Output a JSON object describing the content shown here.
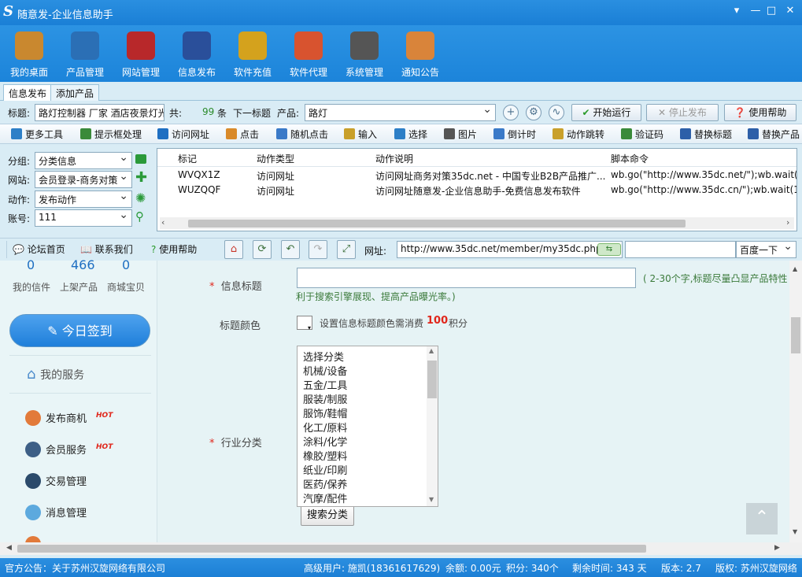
{
  "app": {
    "logo": "S",
    "title": "随意发-企业信息助手",
    "win_controls": [
      "▾",
      "—",
      "□",
      "✕"
    ]
  },
  "toolbar": [
    {
      "label": "我的桌面",
      "icon": "house-icon",
      "color": "#c9882f"
    },
    {
      "label": "产品管理",
      "icon": "cloud-box-icon",
      "color": "#2b6fb5"
    },
    {
      "label": "网站管理",
      "icon": "building-icon",
      "color": "#b8282a"
    },
    {
      "label": "信息发布",
      "icon": "magic-wand-icon",
      "color": "#2a4f9a"
    },
    {
      "label": "软件充值",
      "icon": "chart-coins-icon",
      "color": "#d4a21d"
    },
    {
      "label": "软件代理",
      "icon": "gift-icon",
      "color": "#d8532f"
    },
    {
      "label": "系统管理",
      "icon": "gear-icon",
      "color": "#555555"
    },
    {
      "label": "通知公告",
      "icon": "notepad-icon",
      "color": "#d9843a"
    }
  ],
  "tabs": [
    "信息发布",
    "添加产品"
  ],
  "row1": {
    "title_label": "标题:",
    "title_value": "路灯控制器 厂家 酒店夜景灯光",
    "total_label": "共:",
    "count": "99",
    "unit": "条",
    "next_label": "下一标题",
    "product_label": "产品:",
    "product_value": "路灯",
    "start_label": "开始运行",
    "stop_label": "停止发布",
    "help_label": "使用帮助"
  },
  "row2": [
    {
      "label": "更多工具",
      "color": "#2d7fc7"
    },
    {
      "label": "提示框处理",
      "color": "#3a8a3a"
    },
    {
      "label": "访问网址",
      "color": "#1f6fc2"
    },
    {
      "label": "点击",
      "color": "#d98a2a"
    },
    {
      "label": "随机点击",
      "color": "#3b7ac8"
    },
    {
      "label": "输入",
      "color": "#c9a02a"
    },
    {
      "label": "选择",
      "color": "#2d7fc7"
    },
    {
      "label": "图片",
      "color": "#555555"
    },
    {
      "label": "倒计时",
      "color": "#3b7ac8"
    },
    {
      "label": "动作跳转",
      "color": "#c9a02a"
    },
    {
      "label": "验证码",
      "color": "#3a8a3a"
    },
    {
      "label": "替换标题",
      "color": "#2d5fa8"
    },
    {
      "label": "替换产品",
      "color": "#2d5fa8"
    }
  ],
  "leftform": {
    "group_label": "分组:",
    "group_value": "分类信息",
    "site_label": "网站:",
    "site_value": "会员登录-商务对策",
    "action_label": "动作:",
    "action_value": "发布动作",
    "account_label": "账号:",
    "account_value": "111"
  },
  "grid": {
    "headers": [
      "标记",
      "动作类型",
      "动作说明",
      "脚本命令"
    ],
    "rows": [
      [
        "WVQX1Z",
        "访问网址",
        "访问网址商务对策35dc.net - 中国专业B2B产品推广...",
        "wb.go(\"http://www.35dc.net/\");wb.wait("
      ],
      [
        "WUZQQF",
        "访问网址",
        "访问网址随意发-企业信息助手-免费信息发布软件",
        "wb.go(\"http://www.35dc.cn/\");wb.wait(1"
      ]
    ]
  },
  "row3": {
    "links": [
      "论坛首页",
      "联系我们",
      "使用帮助"
    ],
    "url_label": "网址:",
    "url_value": "http://www.35dc.net/member/my35dc.php",
    "search_value": "",
    "search_engine": "百度一下"
  },
  "sidebar": {
    "stats": [
      {
        "num": "0",
        "label": "我的信件"
      },
      {
        "num": "466",
        "label": "上架产品"
      },
      {
        "num": "0",
        "label": "商城宝贝"
      }
    ],
    "checkin": "今日签到",
    "my_service": "我的服务",
    "items": [
      {
        "label": "发布商机",
        "hot": "HOT",
        "color": "#e27a3a"
      },
      {
        "label": "会员服务",
        "hot": "HOT",
        "color": "#3d5f86"
      },
      {
        "label": "交易管理",
        "hot": "",
        "color": "#2b4a6b"
      },
      {
        "label": "消息管理",
        "hot": "",
        "color": "#5ca9de"
      },
      {
        "label": "",
        "hot": "",
        "color": "#e27a3a"
      }
    ]
  },
  "form": {
    "title_label": "信息标题",
    "title_hint": "( 2-30个字,标题尽量凸显产品特性",
    "title_hint2": "利于搜索引擎展现、提高产品曝光率。)",
    "color_label": "标题颜色",
    "color_note": "设置信息标题颜色需消费",
    "color_cost": "100",
    "color_unit": "积分",
    "industry_label": "行业分类",
    "categories": [
      "选择分类",
      "机械/设备",
      "五金/工具",
      "服装/制服",
      "服饰/鞋帽",
      "化工/原料",
      "涂料/化学",
      "橡胶/塑料",
      "纸业/印刷",
      "医药/保养",
      "汽摩/配件"
    ],
    "search_btn": "搜索分类"
  },
  "status": {
    "notice": "官方公告：关于苏州汉旋网络有限公司",
    "user": "高级用户: 施凯(18361617629)",
    "balance": "余额: 0.00元",
    "points": "积分: 340个",
    "remain": "剩余时间: 343 天",
    "version": "版本: 2.7",
    "copyright": "版权: 苏州汉旋网络"
  }
}
